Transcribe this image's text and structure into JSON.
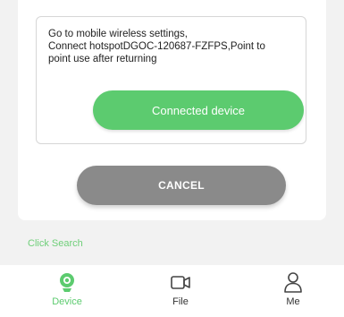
{
  "dialog": {
    "message": "Go to mobile wireless settings,\nConnect hotspotDGOC-120687-FZFPS,Point to\npoint use after returning",
    "connect_label": "Connected device",
    "cancel_label": "CANCEL"
  },
  "click_search_label": "Click Search",
  "nav": {
    "items": [
      {
        "label": "Device",
        "icon": "camera-icon",
        "active": true
      },
      {
        "label": "File",
        "icon": "video-icon",
        "active": false
      },
      {
        "label": "Me",
        "icon": "person-icon",
        "active": false
      }
    ]
  },
  "colors": {
    "accent": "#5ccb6f",
    "cancel": "#8a8a8a",
    "link": "#6fcf79"
  }
}
